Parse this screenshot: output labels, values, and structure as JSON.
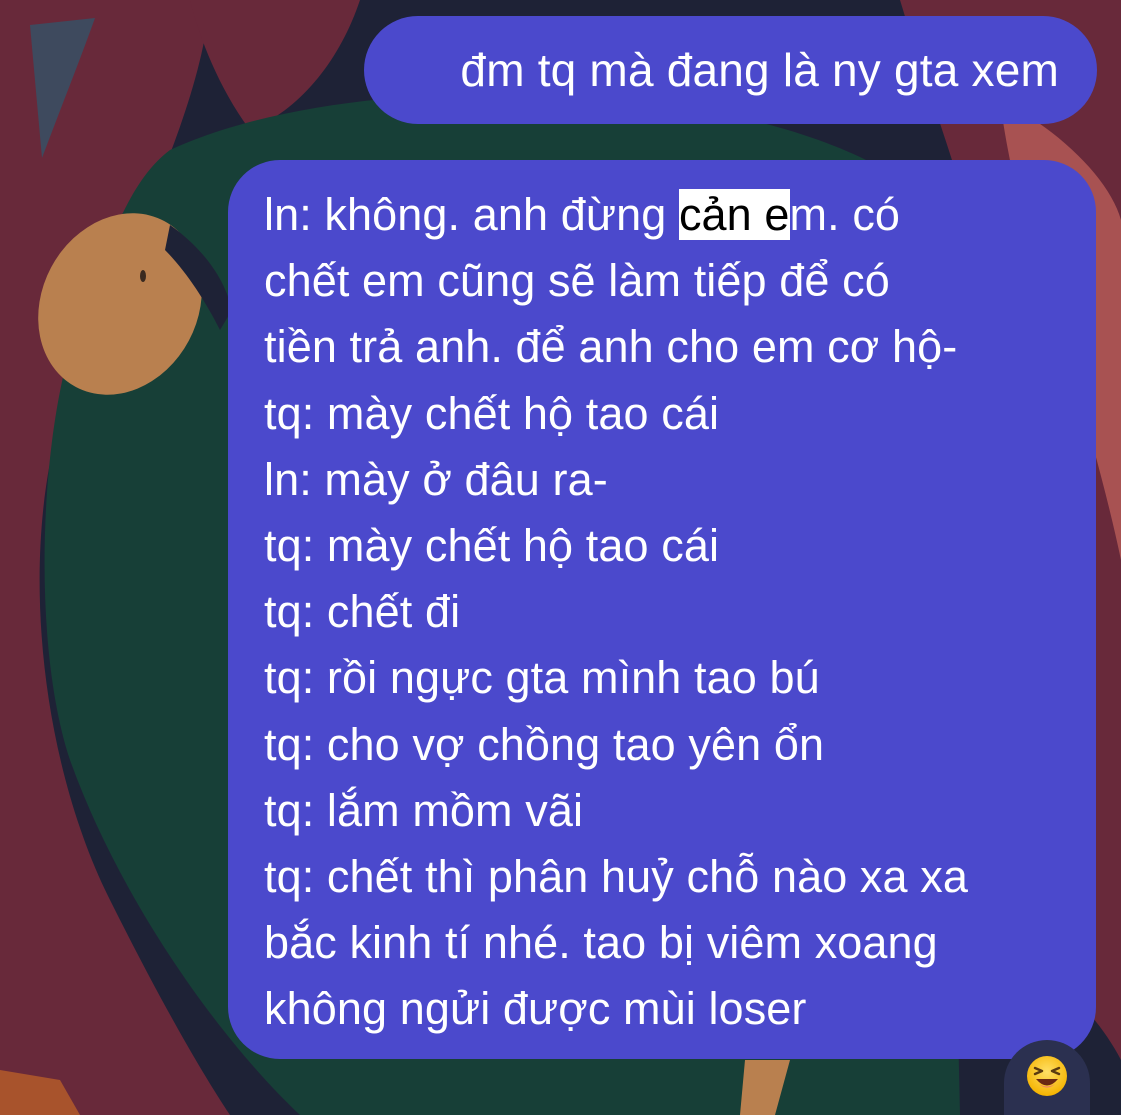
{
  "wallpaper": {
    "colors": {
      "base": "#1e2236",
      "maroon": "#68293a",
      "green": "#173f37",
      "tan": "#b9804f",
      "salmon": "#b45a52",
      "gray": "#3e4a5e",
      "bubble": "#4b49cc"
    }
  },
  "messages": {
    "top": {
      "text": "đm tq mà đang là ny gta xem"
    },
    "main": {
      "line1_before": "ln: không. anh đừng ",
      "line1_highlight": "cản e",
      "line1_after": "m. có",
      "lines": [
        "chết em cũng sẽ làm tiếp để có",
        "tiền trả anh. để anh cho em cơ hộ-",
        "tq: mày chết hộ tao cái",
        "ln: mày ở đâu ra-",
        "tq: mày chết hộ tao cái",
        "tq: chết đi",
        "tq: rồi ngực gta mình tao bú",
        "tq: cho vợ chồng tao yên ổn",
        "tq: lắm mồm vãi",
        "tq: chết thì phân huỷ chỗ nào xa xa",
        "bắc kinh tí nhé. tao bị viêm xoang",
        "không ngửi được mùi loser"
      ]
    }
  },
  "reaction": {
    "icon": "laughing-squint-face-icon"
  }
}
